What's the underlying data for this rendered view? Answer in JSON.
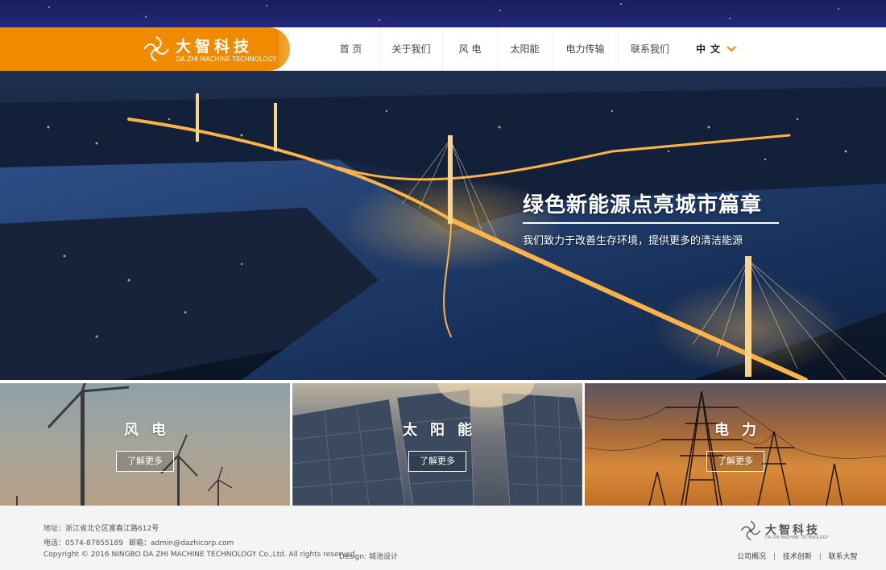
{
  "brand": {
    "name": "大智科技",
    "subtitle": "DA ZHI MACHINE TECHNOLOGY",
    "accent": "#f08a00"
  },
  "nav": {
    "items": [
      {
        "label": "首 页"
      },
      {
        "label": "关于我们"
      },
      {
        "label": "风 电"
      },
      {
        "label": "太阳能"
      },
      {
        "label": "电力传输"
      },
      {
        "label": "联系我们"
      }
    ],
    "language": "中文"
  },
  "hero": {
    "title": "绿色新能源点亮城市篇章",
    "subtitle": "我们致力于改善生存环境，提供更多的清洁能源"
  },
  "tiles": [
    {
      "title": "风电",
      "button": "了解更多"
    },
    {
      "title": "太阳能",
      "button": "了解更多"
    },
    {
      "title": "电力",
      "button": "了解更多"
    }
  ],
  "footer": {
    "address": "地址：浙江省北仑区富春江路612号",
    "phone": "电话：0574-87855189",
    "email": "邮箱：admin@dazhicorp.com",
    "copyright": "Copyright © 2016 NINGBO DA ZHI MACHINE TECHNOLOGY Co.,Ltd. All rights reserved.",
    "design": "Design: 城池设计",
    "logo_name": "大智科技",
    "logo_subtitle": "DA ZHI MACHINE TECHNOLOGY",
    "links": [
      "公司概况",
      "技术创新",
      "联系大智"
    ]
  }
}
